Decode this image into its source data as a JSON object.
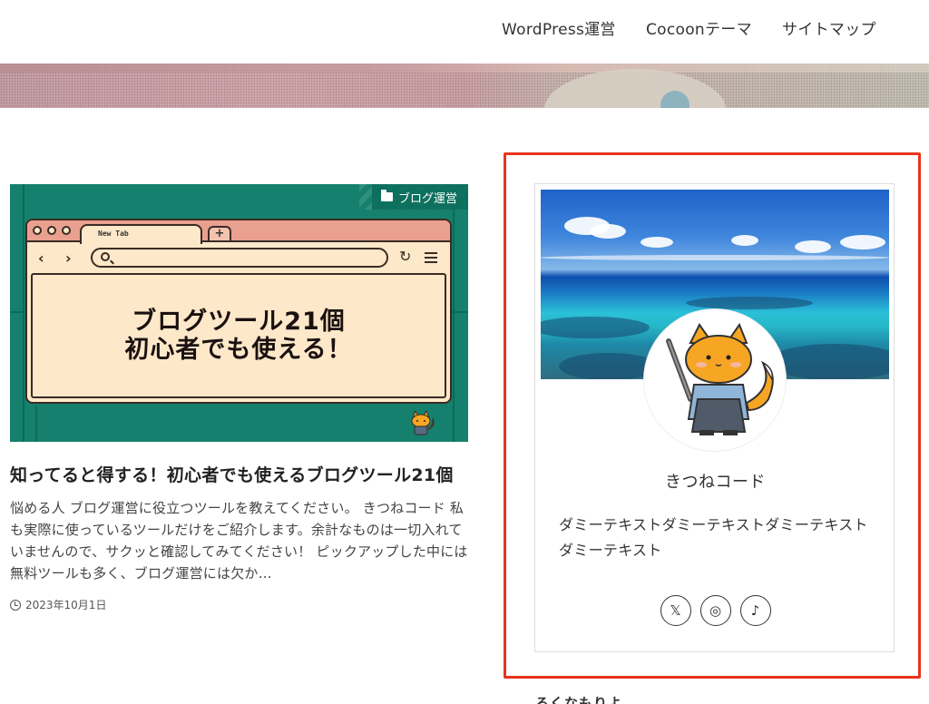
{
  "nav": {
    "items": [
      {
        "label": "WordPress運営"
      },
      {
        "label": "Cocoonテーマ"
      },
      {
        "label": "サイトマップ"
      }
    ]
  },
  "post": {
    "category": "ブログ運営",
    "thumbnail": {
      "tab_label": "New Tab",
      "tab_plus": "+",
      "headline_line1": "ブログツール21個",
      "headline_line2": "初心者でも使える！"
    },
    "title": "知ってると得する！初心者でも使えるブログツール21個",
    "excerpt": "悩める人 ブログ運営に役立つツールを教えてください。 きつねコード 私も実際に使っているツールだけをご紹介します。余計なものは一切入れていませんので、サクッと確認してみてください！ ピックアップした中には無料ツールも多く、ブログ運営には欠か…",
    "date": "2023年10月1日"
  },
  "profile": {
    "name": "きつねコード",
    "description": "ダミーテキストダミーテキストダミーテキストダミーテキスト",
    "socials": [
      {
        "icon": "x-icon",
        "glyph": "𝕏"
      },
      {
        "icon": "instagram-icon",
        "glyph": "◎"
      },
      {
        "icon": "tiktok-icon",
        "glyph": "♪"
      }
    ]
  },
  "sidebar": {
    "next_heading": "ろくなもりよ"
  },
  "colors": {
    "highlight": "#e8341c",
    "thumb_bg": "#15806d",
    "cream": "#fde8c9"
  }
}
